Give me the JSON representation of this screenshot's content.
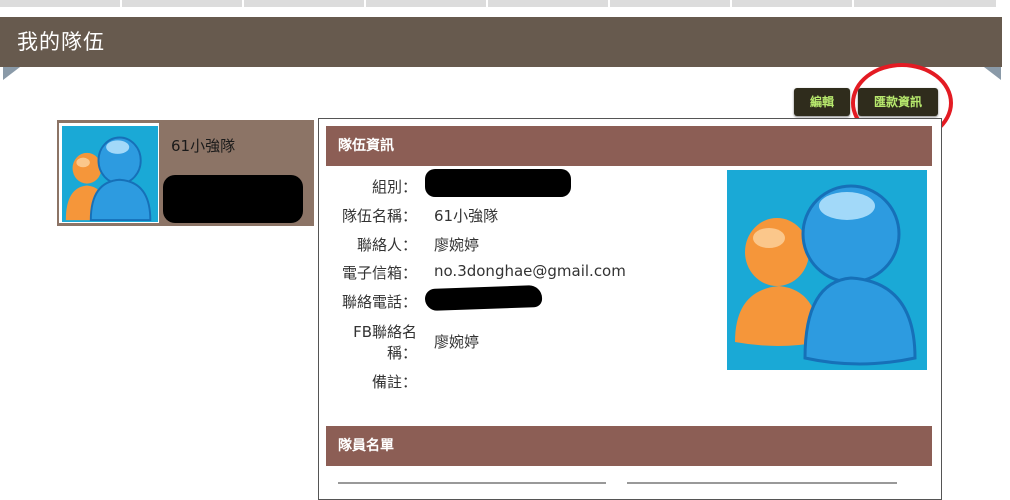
{
  "page": {
    "title": "我的隊伍"
  },
  "actions": {
    "edit_label": "編輯",
    "remit_label": "匯款資訊",
    "highlight_color": "#e31b23"
  },
  "team_card": {
    "name": "61小強隊",
    "avatar_icon": "users-icon"
  },
  "team_info": {
    "header": "隊伍資訊",
    "fields": [
      {
        "label": "組別：",
        "value": ""
      },
      {
        "label": "隊伍名稱：",
        "value": "61小強隊"
      },
      {
        "label": "聯絡人：",
        "value": "廖婉婷"
      },
      {
        "label": "電子信箱：",
        "value": "no.3donghae@gmail.com"
      },
      {
        "label": "聯絡電話：",
        "value": ""
      },
      {
        "label_line1": "FB聯絡名",
        "label_line2": "稱：",
        "value": "廖婉婷"
      },
      {
        "label": "備註：",
        "value": ""
      }
    ]
  },
  "members": {
    "header": "隊員名單"
  },
  "colors": {
    "title_bar": "#675a4e",
    "section_header": "#8c5e55",
    "team_card_bg": "#8c7466",
    "button_bg": "#2f2c1c",
    "button_text": "#b7e86d"
  }
}
